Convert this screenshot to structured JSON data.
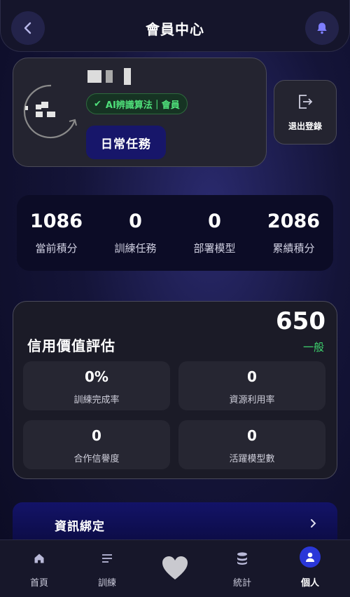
{
  "header": {
    "title": "會員中心",
    "back_icon": "chevron-left-icon",
    "bell_icon": "bell-icon"
  },
  "profile": {
    "badge_check": "✔",
    "badge_text": "AI辨識算法｜會員",
    "daily_task_label": "日常任務"
  },
  "logout": {
    "label": "退出登錄",
    "icon": "logout-icon"
  },
  "stats": [
    {
      "value": "1086",
      "label": "當前積分"
    },
    {
      "value": "0",
      "label": "訓練任務"
    },
    {
      "value": "0",
      "label": "部署模型"
    },
    {
      "value": "2086",
      "label": "累績積分"
    }
  ],
  "credit": {
    "title": "信用價值評估",
    "score": "650",
    "level": "一般",
    "metrics": [
      {
        "value": "0%",
        "label": "訓練完成率"
      },
      {
        "value": "0",
        "label": "資源利用率"
      },
      {
        "value": "0",
        "label": "合作信譽度"
      },
      {
        "value": "0",
        "label": "活躍模型數"
      }
    ]
  },
  "info_binding": {
    "label": "資訊綁定"
  },
  "nav": [
    {
      "label": "首頁",
      "icon": "home-icon"
    },
    {
      "label": "訓練",
      "icon": "list-icon"
    },
    {
      "label": "",
      "icon": "heart-icon"
    },
    {
      "label": "統計",
      "icon": "database-icon"
    },
    {
      "label": "個人",
      "icon": "user-icon"
    }
  ],
  "colors": {
    "accent_green": "#3ed36e",
    "nav_active": "#2a37d8",
    "button_navy": "#17166a"
  }
}
